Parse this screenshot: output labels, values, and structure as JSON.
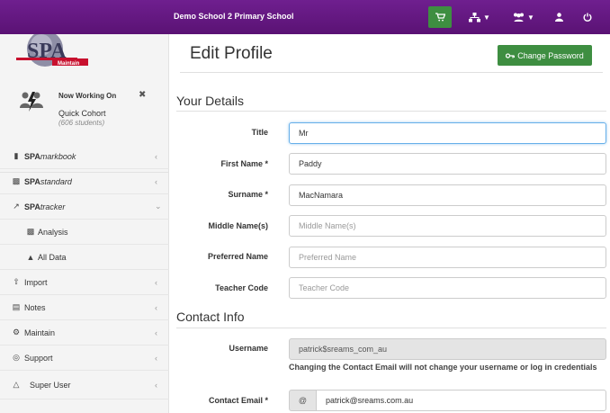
{
  "header": {
    "school_name": "Demo School 2 Primary School"
  },
  "sidebar": {
    "logo_text": "SPA",
    "logo_sub": "Maintain",
    "now_working_on": "Now Working On",
    "cohort": "Quick Cohort",
    "students": "(606 students)",
    "menu": [
      {
        "prefix": "SPA",
        "suffix": "markbook"
      },
      {
        "prefix": "SPA",
        "suffix": "standard"
      },
      {
        "prefix": "SPA",
        "suffix": "tracker"
      },
      {
        "label": "Analysis"
      },
      {
        "label": "All Data"
      },
      {
        "label": "Import"
      },
      {
        "label": "Notes"
      },
      {
        "label": "Maintain"
      },
      {
        "label": "Support"
      },
      {
        "label": "Super User"
      }
    ]
  },
  "main": {
    "title": "Edit Profile",
    "change_password": "Change Password",
    "your_details": "Your Details",
    "contact_info": "Contact Info",
    "fields": {
      "title": {
        "label": "Title",
        "value": "Mr"
      },
      "first_name": {
        "label": "First Name *",
        "value": "Paddy"
      },
      "surname": {
        "label": "Surname *",
        "value": "MacNamara"
      },
      "middle_names": {
        "label": "Middle Name(s)",
        "placeholder": "Middle Name(s)"
      },
      "preferred_name": {
        "label": "Preferred Name",
        "placeholder": "Preferred Name"
      },
      "teacher_code": {
        "label": "Teacher Code",
        "placeholder": "Teacher Code"
      },
      "username": {
        "label": "Username",
        "value": "patrick$sreams_com_au"
      },
      "contact_email": {
        "label": "Contact Email *",
        "addon": "@",
        "value": "patrick@sreams.com.au"
      }
    },
    "username_help": "Changing the Contact Email will not change your username or log in credentials"
  },
  "colors": {
    "topbar": "#5a1274",
    "accent_green": "#3e8e41"
  }
}
